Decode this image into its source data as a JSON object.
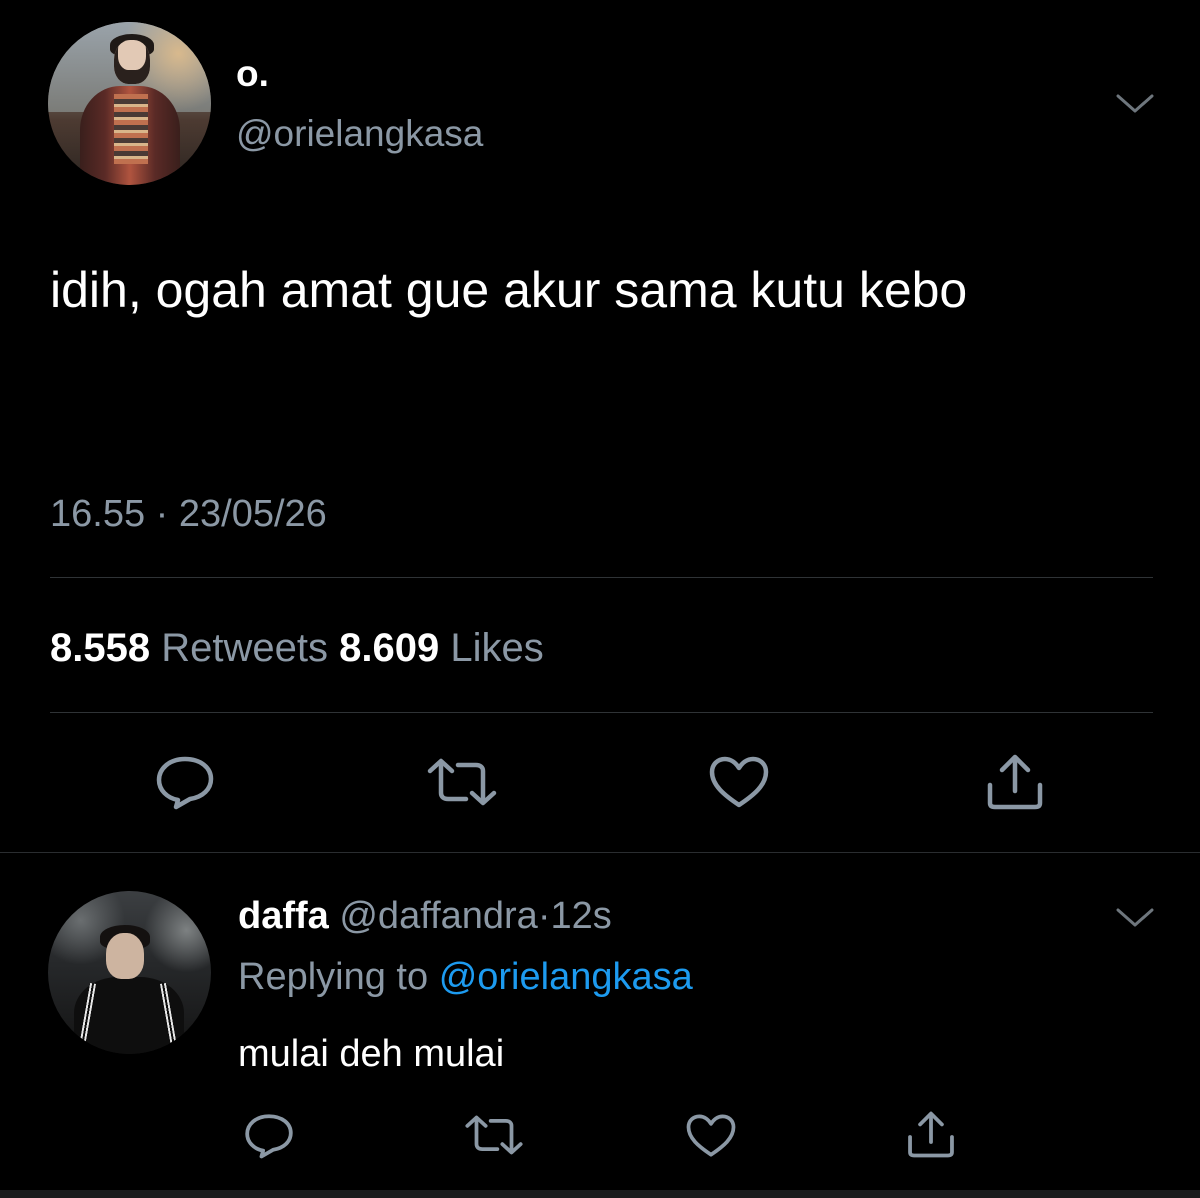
{
  "main_tweet": {
    "display_name": "o.",
    "handle": "@orielangkasa",
    "text": "idih, ogah amat gue akur sama kutu kebo",
    "timestamp": "16.55 · 23/05/26",
    "retweets_count": "8.558",
    "retweets_label": "Retweets",
    "likes_count": "8.609",
    "likes_label": "Likes",
    "actions": [
      "reply-icon",
      "retweet-icon",
      "like-icon",
      "share-icon"
    ]
  },
  "reply_tweet": {
    "display_name": "daffa",
    "handle": "@daffandra",
    "separator": "·",
    "time": "12s",
    "replying_label": "Replying to",
    "replying_to": "@orielangkasa",
    "text": "mulai deh mulai",
    "actions": [
      "reply-icon",
      "retweet-icon",
      "like-icon",
      "share-icon"
    ]
  },
  "colors": {
    "background": "#000000",
    "primary_text": "#ffffff",
    "secondary_text": "#8b98a5",
    "link": "#1d9bf0",
    "divider": "#2f3336"
  }
}
